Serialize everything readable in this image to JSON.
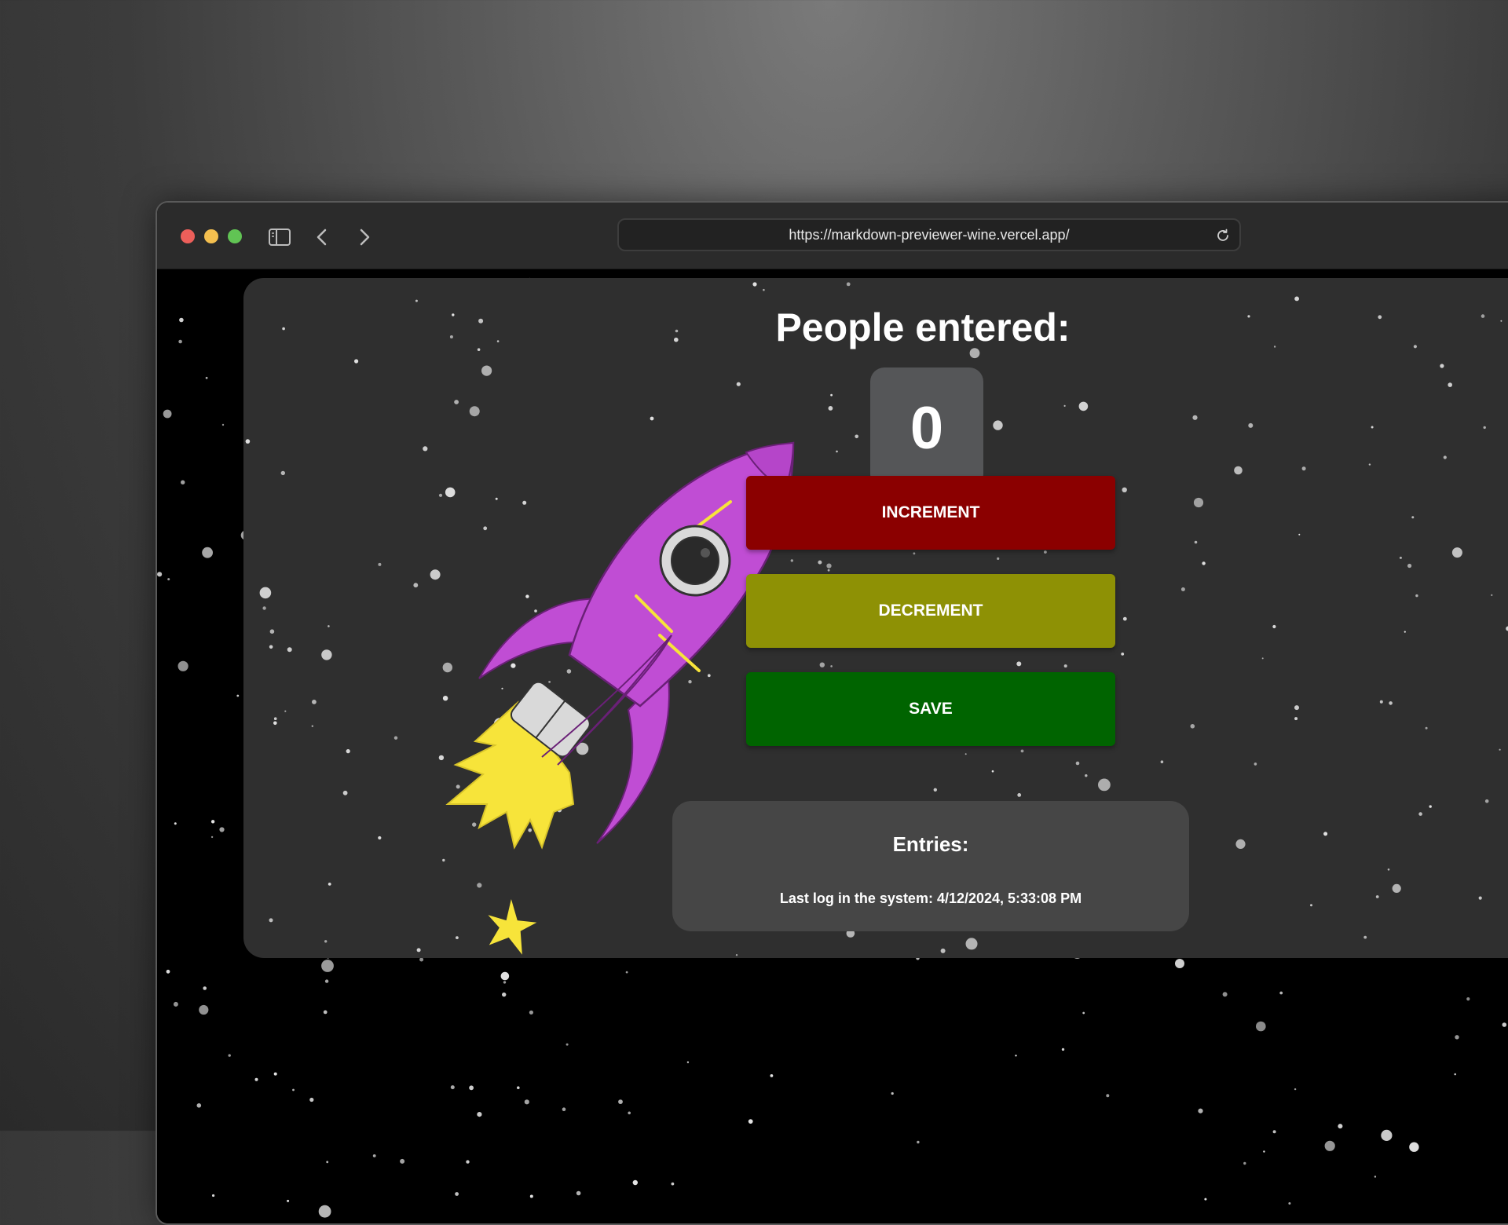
{
  "browser": {
    "url": "https://markdown-previewer-wine.vercel.app/",
    "traffic_lights": {
      "close": "#ec5f5a",
      "minimize": "#f4bf4f",
      "zoom": "#61c454"
    }
  },
  "app": {
    "title": "People entered:",
    "count": "0",
    "buttons": {
      "increment": {
        "label": "INCREMENT",
        "color": "#8b0000"
      },
      "decrement": {
        "label": "DECREMENT",
        "color": "#8e9105"
      },
      "save": {
        "label": "SAVE",
        "color": "#006400"
      }
    },
    "entries": {
      "heading": "Entries:",
      "last_log": "Last log in the system: 4/12/2024, 5:33:08 PM"
    }
  },
  "illustration": {
    "rocket_colors": {
      "body": "#c04dd4",
      "flame": "#f7e43a",
      "window": "#d9d9d9"
    }
  }
}
